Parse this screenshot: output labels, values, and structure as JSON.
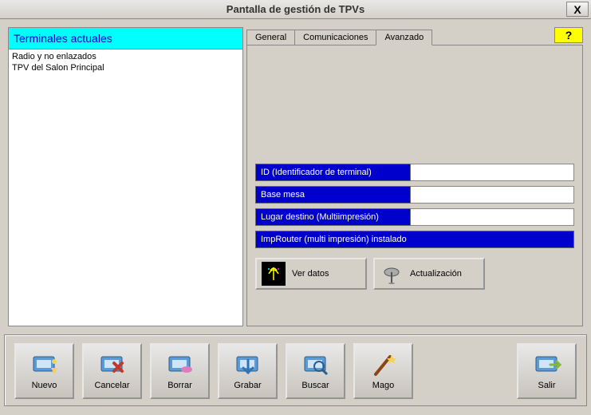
{
  "window": {
    "title": "Pantalla de gestión de TPVs",
    "close_label": "X"
  },
  "sidebar": {
    "header": "Terminales actuales",
    "items": [
      "Radio y no enlazados",
      "TPV del Salon Principal"
    ]
  },
  "tabs": {
    "items": [
      "General",
      "Comunicaciones",
      "Avanzado"
    ],
    "active": "Avanzado",
    "help_label": "?"
  },
  "fields": {
    "id": {
      "label": "ID (Identificador de terminal)",
      "value": ""
    },
    "base_mesa": {
      "label": "Base mesa",
      "value": ""
    },
    "lugar_destino": {
      "label": "Lugar destino (Multiimpresión)",
      "value": ""
    },
    "improuter": {
      "label": "ImpRouter (multi impresión) instalado"
    }
  },
  "actions": {
    "ver_datos": "Ver datos",
    "actualizacion": "Actualización"
  },
  "toolbar": {
    "nuevo": "Nuevo",
    "cancelar": "Cancelar",
    "borrar": "Borrar",
    "grabar": "Grabar",
    "buscar": "Buscar",
    "mago": "Mago",
    "salir": "Salir"
  }
}
